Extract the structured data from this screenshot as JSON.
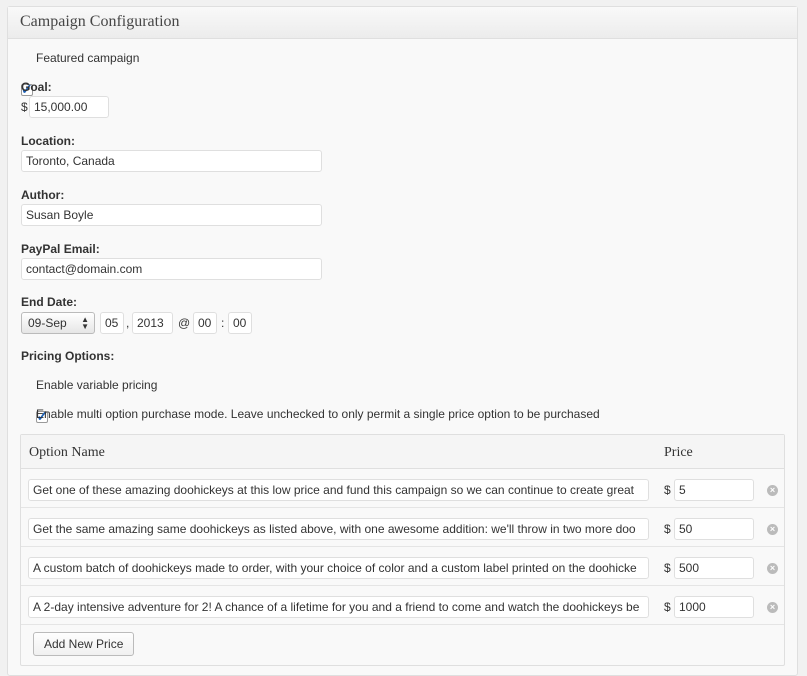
{
  "box": {
    "title": "Campaign Configuration"
  },
  "featured": {
    "label": "Featured campaign",
    "checked": true
  },
  "goal": {
    "label": "Goal:",
    "currency": "$",
    "value": "15,000.00"
  },
  "location": {
    "label": "Location:",
    "value": "Toronto, Canada"
  },
  "author": {
    "label": "Author:",
    "value": "Susan Boyle"
  },
  "paypal": {
    "label": "PayPal Email:",
    "value": "contact@domain.com"
  },
  "end_date": {
    "label": "End Date:",
    "month": "09-Sep",
    "day": "05",
    "comma": ",",
    "year": "2013",
    "at": "@",
    "hour": "00",
    "colon": ":",
    "minute": "00"
  },
  "pricing": {
    "label": "Pricing Options:",
    "variable_label": "Enable variable pricing",
    "variable_checked": true,
    "multi_label": "Enable multi option purchase mode. Leave unchecked to only permit a single price option to be purchased",
    "multi_checked": false
  },
  "price_table": {
    "col_name": "Option Name",
    "col_price": "Price",
    "currency": "$",
    "rows": [
      {
        "name": "Get one of these amazing doohickeys at this low price and fund this campaign so we can continue to create great",
        "price": "5"
      },
      {
        "name": "Get the same amazing same doohickeys as listed above, with one awesome addition: we'll throw in two more doo",
        "price": "50"
      },
      {
        "name": "A custom batch of doohickeys made to order, with your choice of color and a custom label printed on the doohicke",
        "price": "500"
      },
      {
        "name": "A 2-day intensive adventure for 2! A chance of a lifetime for you and a friend to come and watch the doohickeys be",
        "price": "1000"
      }
    ],
    "add_button": "Add New Price",
    "remove_icon": "close-circle-icon"
  }
}
